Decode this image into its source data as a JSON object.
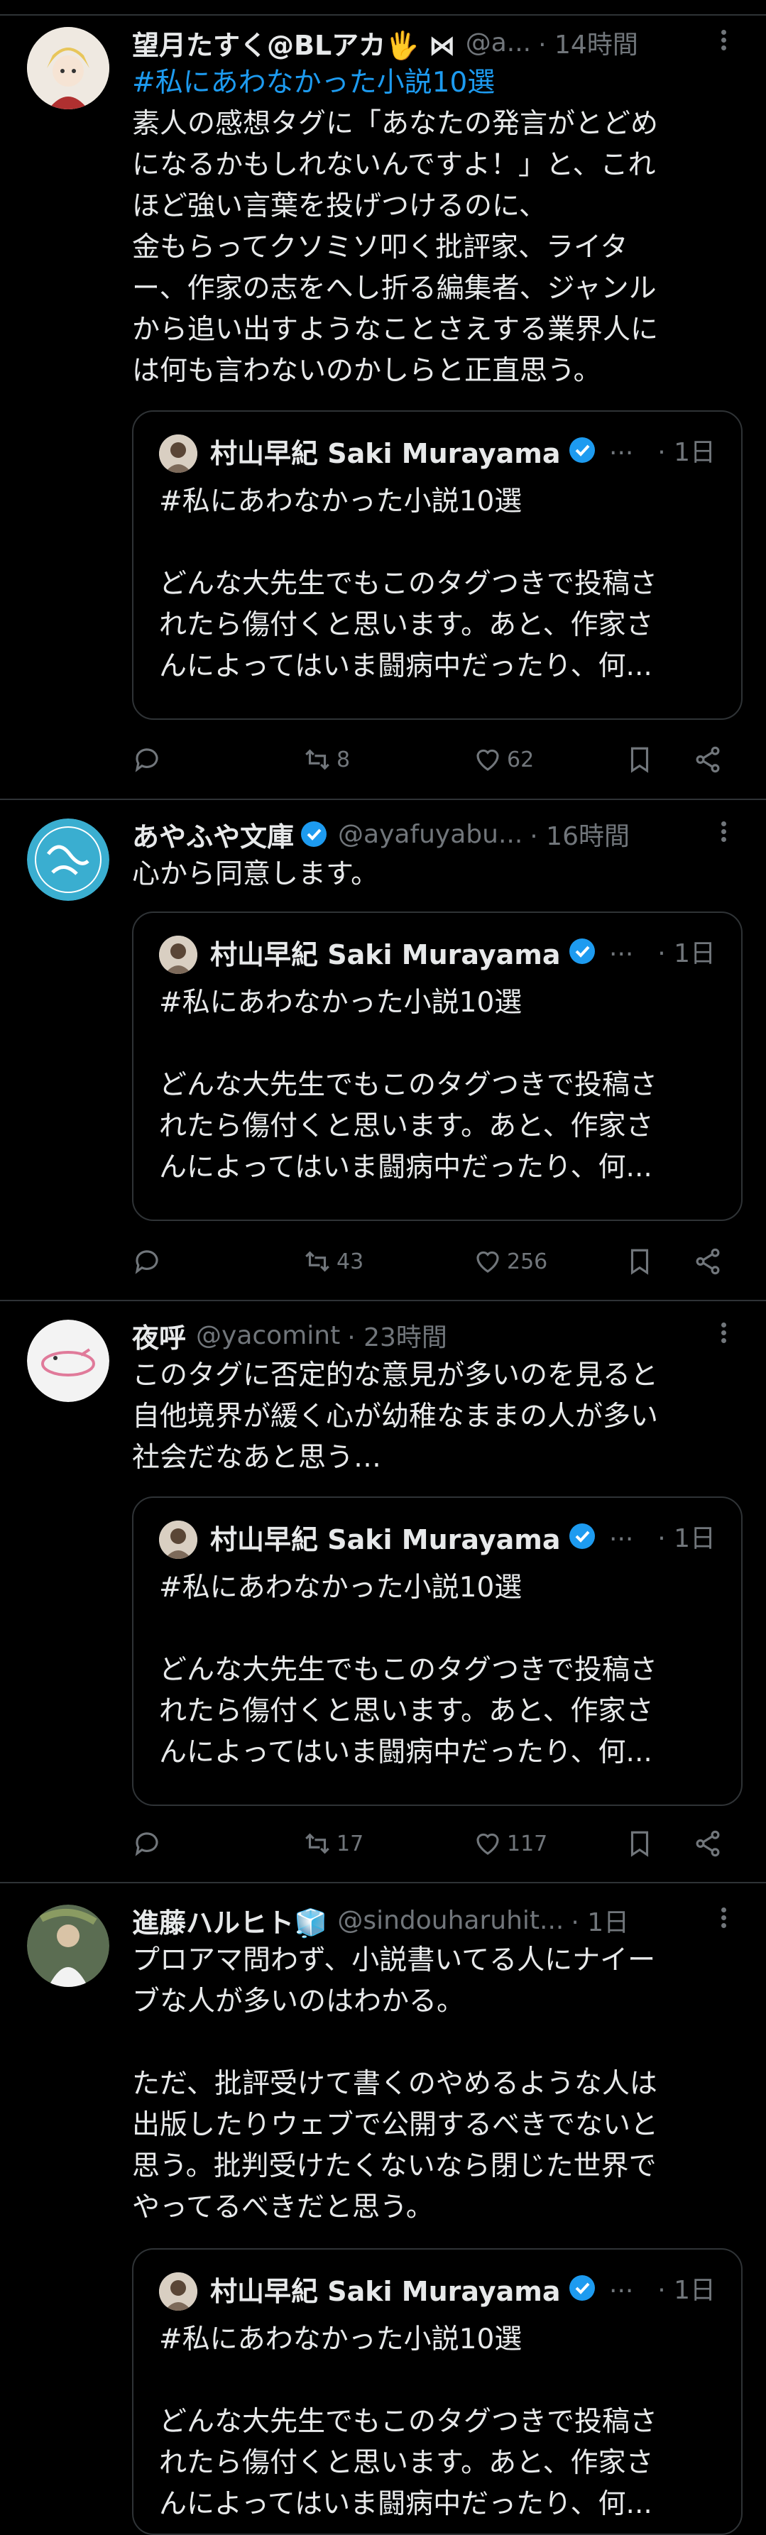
{
  "tweets": [
    {
      "name": "望月たすく@BLアカ🖐 ⋈",
      "handle": "@a...",
      "time": "· 14時間",
      "hashtag": "#私にあわなかった小説10選",
      "text": "素人の感想タグに「あなたの発言がとどめ\nになるかもしれないんですよ！」と、これ\nほど強い言葉を投げつけるのに、\n金もらってクソミソ叩く批評家、ライタ\nー、作家の志をへし折る編集者、ジャンル\nから追い出すようなことさえする業界人に\nは何も言わないのかしらと正直思う。",
      "actions": {
        "reply": "",
        "retweets": "8",
        "likes": "62"
      }
    },
    {
      "name": "あやふや文庫",
      "handle": "@ayafuyabu...",
      "time": "· 16時間",
      "hashtag": "",
      "text": "心から同意します。",
      "actions": {
        "reply": "",
        "retweets": "43",
        "likes": "256"
      }
    },
    {
      "name": "夜呼",
      "handle": "@yacomint",
      "time": "· 23時間",
      "hashtag": "",
      "text": "このタグに否定的な意見が多いのを見ると\n自他境界が緩く心が幼稚なままの人が多い\n社会だなあと思う…",
      "actions": {
        "reply": "",
        "retweets": "17",
        "likes": "117"
      }
    },
    {
      "name": "進藤ハルヒト🧊",
      "handle": "@sindouharuhit...",
      "time": "· 1日",
      "hashtag": "",
      "text": "プロアマ問わず、小説書いてる人にナイー\nブな人が多いのはわかる。\n\nただ、批評受けて書くのやめるような人は\n出版したりウェブで公開するべきでないと\n思う。批判受けたくないなら閉じた世界で\nやってるべきだと思う。",
      "actions": {
        "reply": "",
        "retweets": "",
        "likes": ""
      }
    }
  ],
  "quoted": {
    "name": "村山早紀 Saki Murayama",
    "ellipsis": "...",
    "time": "· 1日",
    "text": "#私にあわなかった小説10選\n\nどんな大先生でもこのタグつきで投稿さ\nれたら傷付くと思います。あと、作家さ\nんによってはいま闘病中だったり、何..."
  },
  "colors": {
    "background": "#000000",
    "text": "#e7e9ea",
    "muted": "#71767b",
    "accent": "#1d9bf0",
    "border": "#2f3336"
  },
  "icons": [
    "reply-icon",
    "retweet-icon",
    "like-icon",
    "bookmark-icon",
    "share-icon",
    "more-icon",
    "verified-badge-icon"
  ]
}
